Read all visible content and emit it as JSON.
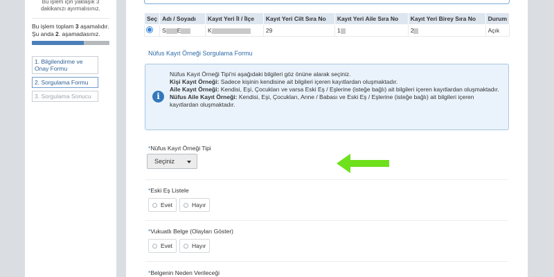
{
  "sidebar": {
    "top_note_line1": "Bu işlem için yaklaşık 3",
    "top_note_line2": "dakikanızı ayırmalısınız.",
    "steps_info_a": "Bu işlem toplam ",
    "steps_total": "3",
    "steps_info_b": " aşamalıdır. Şu anda ",
    "steps_current": "2",
    "steps_info_c": ". aşamadasınız.",
    "progress_fraction": 0.67,
    "steps": [
      {
        "label": "1. Bilgilendirme ve Onay Formu"
      },
      {
        "label": "2. Sorgulama Formu"
      },
      {
        "label": "3. Sorgulama Sonucu"
      }
    ]
  },
  "table": {
    "headers": [
      "Seç",
      "Adı / Soyadı",
      "Kayıt Yeri İl / İlçe",
      "Kayıt Yeri Cilt Sıra No",
      "Kayıt Yeri Aile Sıra No",
      "Kayıt Yeri Birey Sıra No",
      "Durum"
    ],
    "row": {
      "name_a": "S",
      "name_b": "E",
      "place": "K",
      "cilt": "29",
      "aile": "1",
      "birey": "2",
      "durum": "Açık"
    }
  },
  "section_title": "Nüfus Kayıt Örneği Sorgulama Formu",
  "info": {
    "line1": "Nüfus Kayıt Örneği Tipi'ni aşağıdaki bilgileri göz önüne alarak seçiniz.",
    "kisi_title": "Kişi Kayıt Örneği:",
    "kisi_text": " Sadece kişinin kendisine ait bilgileri içeren kayıtlardan oluşmaktadır.",
    "aile_title": "Aile Kayıt Örneği:",
    "aile_text": " Kendisi, Eşi, Çocukları ve varsa Eski Eş / Eşlerine (isteğe bağlı) ait bilgileri içeren kayıtlardan oluşmaktadır.",
    "nufus_title": "Nüfus Aile Kayıt Örneği:",
    "nufus_text": " Kendisi, Eşi, Çocukları, Anne / Babası ve Eski Eş / Eşlerine (isteğe bağlı) ait bilgileri içeren kayıtlardan oluşmaktadır."
  },
  "form": {
    "required_mark": "*",
    "type_label": "Nüfus Kayıt Örneği Tipi",
    "type_value": "Seçiniz",
    "eski_es_label": "Eski Eş Listele",
    "vukuatli_label": "Vukuatlı Belge (Olayları Göster)",
    "neden_label": "Belgenin Neden Verileceği",
    "yes": "Evet",
    "no": "Hayır"
  },
  "colors": {
    "accent": "#3478bb",
    "arrow": "#6ee01c"
  },
  "icons": {
    "info": "info-circle-icon",
    "arrow": "left-arrow-icon",
    "caret": "caret-down-icon"
  }
}
